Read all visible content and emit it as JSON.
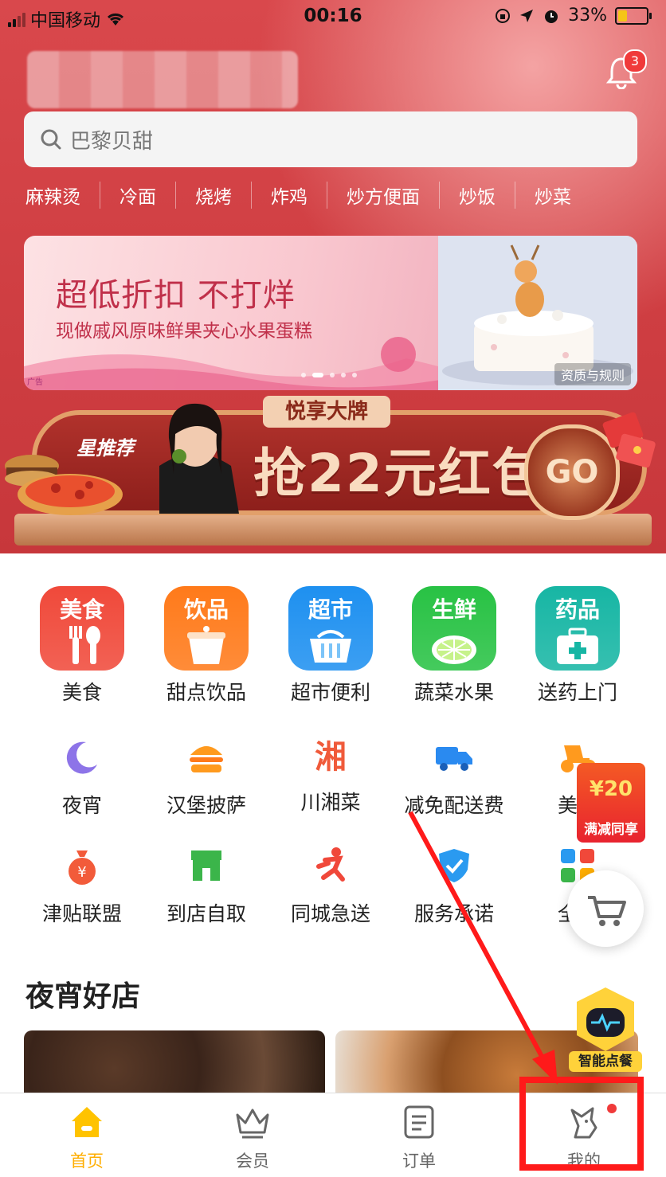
{
  "status_bar": {
    "carrier": "中国移动",
    "time": "00:16",
    "battery": "33%",
    "battery_level": 0.33
  },
  "header": {
    "notification_count": "3"
  },
  "search": {
    "placeholder": "巴黎贝甜"
  },
  "hot_words": [
    "麻辣烫",
    "冷面",
    "烧烤",
    "炸鸡",
    "炒方便面",
    "炒饭",
    "炒菜"
  ],
  "banner1": {
    "title": "超低折扣 不打烊",
    "subtitle": "现做戚风原味鲜果夹心水果蛋糕",
    "ad_label": "广告",
    "rules": "资质与规则"
  },
  "banner2": {
    "tag": "悦享大牌",
    "star_label": "星推荐",
    "headline": "抢22元红包",
    "go": "GO"
  },
  "main_categories": [
    {
      "tile": "美食",
      "label": "美食",
      "color": "#f0493a"
    },
    {
      "tile": "饮品",
      "label": "甜点饮品",
      "color": "#ff7a1a"
    },
    {
      "tile": "超市",
      "label": "超市便利",
      "color": "#1e90f0"
    },
    {
      "tile": "生鲜",
      "label": "蔬菜水果",
      "color": "#28c244"
    },
    {
      "tile": "药品",
      "label": "送药上门",
      "color": "#17b6a4"
    }
  ],
  "sub_categories_row1": [
    {
      "label": "夜宵",
      "icon": "moon-icon"
    },
    {
      "label": "汉堡披萨",
      "icon": "burger-icon"
    },
    {
      "label": "川湘菜",
      "icon": "xiang-char-icon",
      "glyph": "湘"
    },
    {
      "label": "减免配送费",
      "icon": "truck-icon"
    },
    {
      "label": "美团",
      "icon": "scooter-icon"
    }
  ],
  "sub_categories_row2": [
    {
      "label": "津贴联盟",
      "icon": "money-bag-icon"
    },
    {
      "label": "到店自取",
      "icon": "store-icon"
    },
    {
      "label": "同城急送",
      "icon": "runner-icon"
    },
    {
      "label": "服务承诺",
      "icon": "shield-check-icon"
    },
    {
      "label": "全部",
      "icon": "grid-icon"
    }
  ],
  "promo": {
    "amount": "¥20",
    "text": "满减同享"
  },
  "robot": {
    "label": "智能点餐"
  },
  "section": {
    "title": "夜宵好店"
  },
  "tabs": [
    {
      "label": "首页",
      "icon": "home-icon",
      "active": true
    },
    {
      "label": "会员",
      "icon": "crown-icon",
      "active": false
    },
    {
      "label": "订单",
      "icon": "order-list-icon",
      "active": false
    },
    {
      "label": "我的",
      "icon": "kangaroo-icon",
      "active": false
    }
  ],
  "colors": {
    "hero_red": "#d9484c",
    "accent_yellow": "#ffae00",
    "annotation_red": "#ff1a1a"
  }
}
